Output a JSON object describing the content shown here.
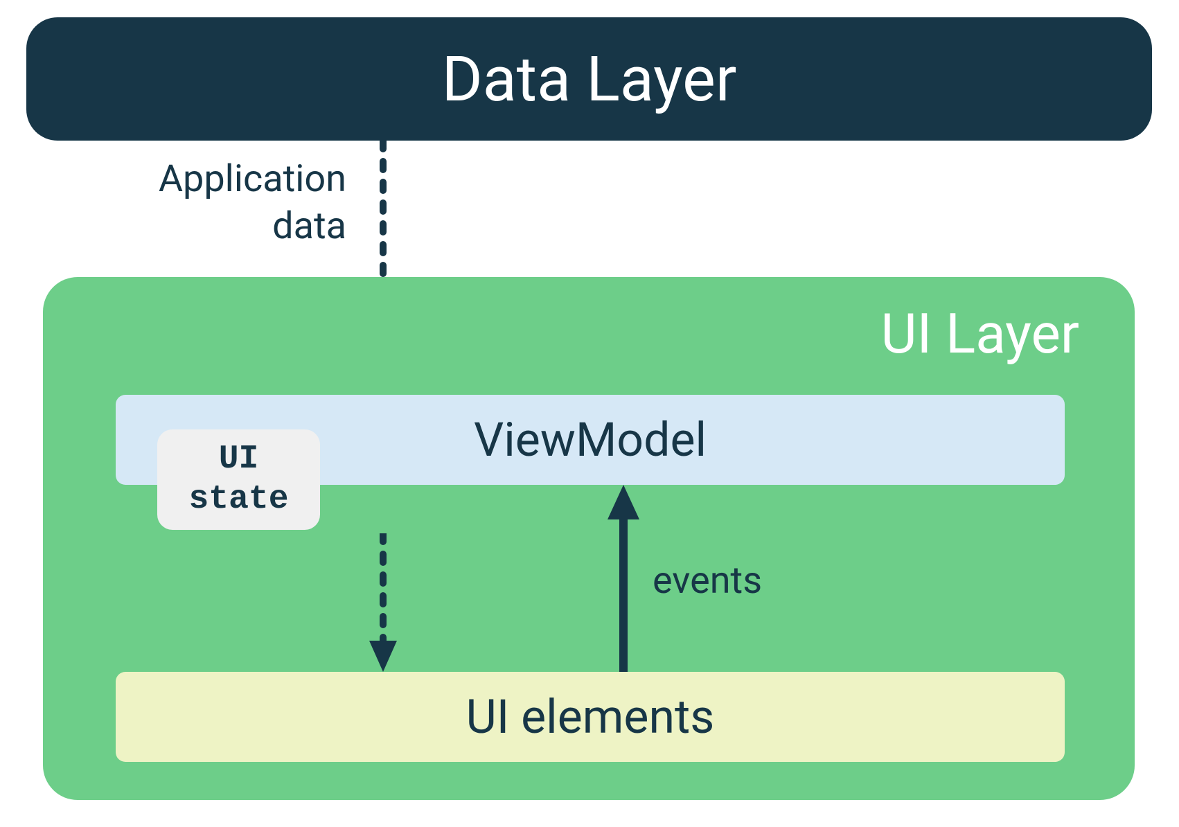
{
  "dataLayer": {
    "title": "Data Layer"
  },
  "arrows": {
    "appDataLabel": "Application\ndata",
    "eventsLabel": "events"
  },
  "uiLayer": {
    "title": "UI Layer",
    "viewModel": "ViewModel",
    "uiState": "UI\nstate",
    "uiElements": "UI elements"
  },
  "colors": {
    "darkNavy": "#173647",
    "green": "#6dce89",
    "lightBlue": "#d6e8f6",
    "lightYellow": "#eef3c5",
    "lightGray": "#f0f0f0"
  }
}
